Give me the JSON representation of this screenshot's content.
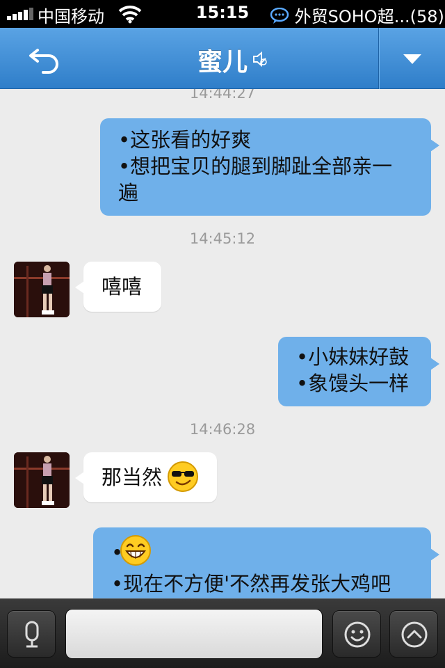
{
  "status_bar": {
    "carrier": "中国移动",
    "time": "15:15",
    "notification": "外贸SOHO超...(58)"
  },
  "nav": {
    "title": "蜜儿",
    "back_icon": "back-arrow-icon",
    "mute_icon": "speaker-muted-icon",
    "dropdown_icon": "triangle-down-icon"
  },
  "messages": [
    {
      "type": "timestamp",
      "text": "14:44:27"
    },
    {
      "type": "outgoing",
      "lines": [
        "•这张看的好爽",
        "•想把宝贝的腿到脚趾全部亲一",
        "遍"
      ]
    },
    {
      "type": "timestamp",
      "text": "14:45:12"
    },
    {
      "type": "incoming",
      "lines": [
        "嘻嘻"
      ]
    },
    {
      "type": "outgoing",
      "lines": [
        "•小妹妹好鼓",
        "•象馒头一样"
      ]
    },
    {
      "type": "timestamp",
      "text": "14:46:28"
    },
    {
      "type": "incoming",
      "lines": [
        "那当然"
      ],
      "emoji": "sunglasses-emoji"
    },
    {
      "type": "outgoing",
      "lines": [
        "•",
        "•现在不方便'不然再发张大鸡吧"
      ],
      "emoji": "grin-emoji"
    }
  ],
  "input_bar": {
    "voice_icon": "microphone-icon",
    "input_value": "",
    "emoji_icon": "smiley-icon",
    "more_icon": "chevron-up-circle-icon"
  },
  "colors": {
    "nav_bar": "#3f8fd8",
    "outgoing_bubble": "#6fb0ea",
    "incoming_bubble": "#ffffff",
    "chat_background": "#ececec"
  }
}
